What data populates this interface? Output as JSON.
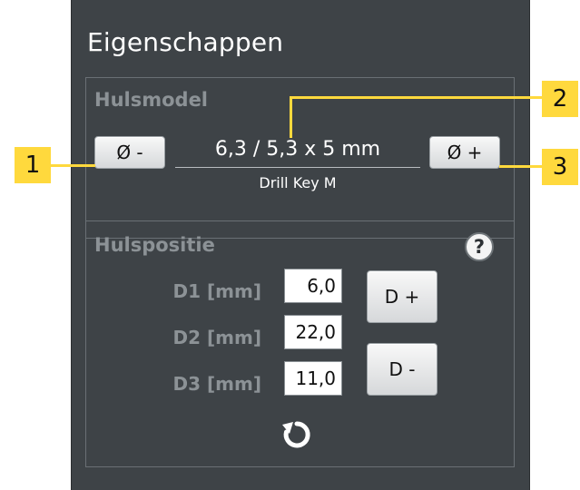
{
  "panel": {
    "title": "Eigenschappen"
  },
  "sleeve_model": {
    "title": "Hulsmodel",
    "decrease_label": "Ø -",
    "increase_label": "Ø +",
    "dimensions": "6,3 / 5,3 x 5 mm",
    "name": "Drill Key M"
  },
  "sleeve_position": {
    "title": "Hulspositie",
    "help_glyph": "?",
    "rows": [
      {
        "label": "D1 [mm]",
        "value": "6,0"
      },
      {
        "label": "D2 [mm]",
        "value": "22,0"
      },
      {
        "label": "D3 [mm]",
        "value": "11,0"
      }
    ],
    "d_plus_label": "D +",
    "d_minus_label": "D -",
    "reset_icon": "reset-icon"
  },
  "callouts": [
    "1",
    "2",
    "3"
  ],
  "colors": {
    "panel_bg": "#3e4347",
    "callout": "#ffd93d",
    "group_title": "#8c9296"
  }
}
